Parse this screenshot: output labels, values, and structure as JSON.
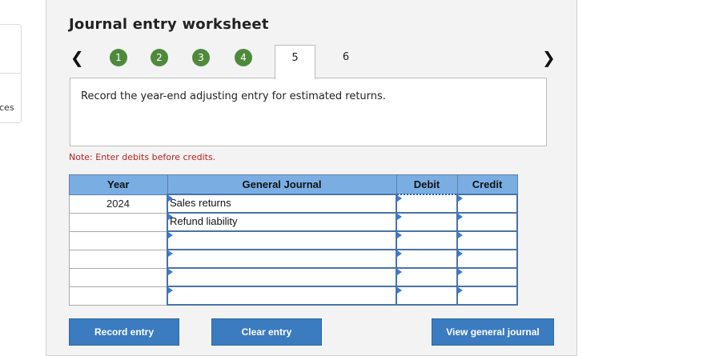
{
  "left_card": {
    "fragment": "ces"
  },
  "worksheet": {
    "title": "Journal entry worksheet",
    "steps": [
      "1",
      "2",
      "3",
      "4"
    ],
    "tabs": [
      "5",
      "6"
    ],
    "prompt": "Record the year-end adjusting entry for estimated returns.",
    "note": "Note: Enter debits before credits.",
    "colors": {
      "step_complete": "#4f8a3c",
      "header_bg": "#7aaee3",
      "button_bg": "#3b7bbf",
      "note": "#b22222"
    }
  },
  "table": {
    "headers": {
      "year": "Year",
      "journal": "General Journal",
      "debit": "Debit",
      "credit": "Credit"
    },
    "rows": [
      {
        "year": "2024",
        "account": "Sales returns",
        "debit": "",
        "credit": ""
      },
      {
        "year": "",
        "account": "Refund liability",
        "debit": "",
        "credit": ""
      },
      {
        "year": "",
        "account": "",
        "debit": "",
        "credit": ""
      },
      {
        "year": "",
        "account": "",
        "debit": "",
        "credit": ""
      },
      {
        "year": "",
        "account": "",
        "debit": "",
        "credit": ""
      },
      {
        "year": "",
        "account": "",
        "debit": "",
        "credit": ""
      }
    ]
  },
  "buttons": {
    "record": "Record entry",
    "clear": "Clear entry",
    "view": "View general journal"
  },
  "icons": {
    "prev": "chevron-left-icon",
    "next": "chevron-right-icon",
    "row_marker": "triangle-right-icon"
  }
}
